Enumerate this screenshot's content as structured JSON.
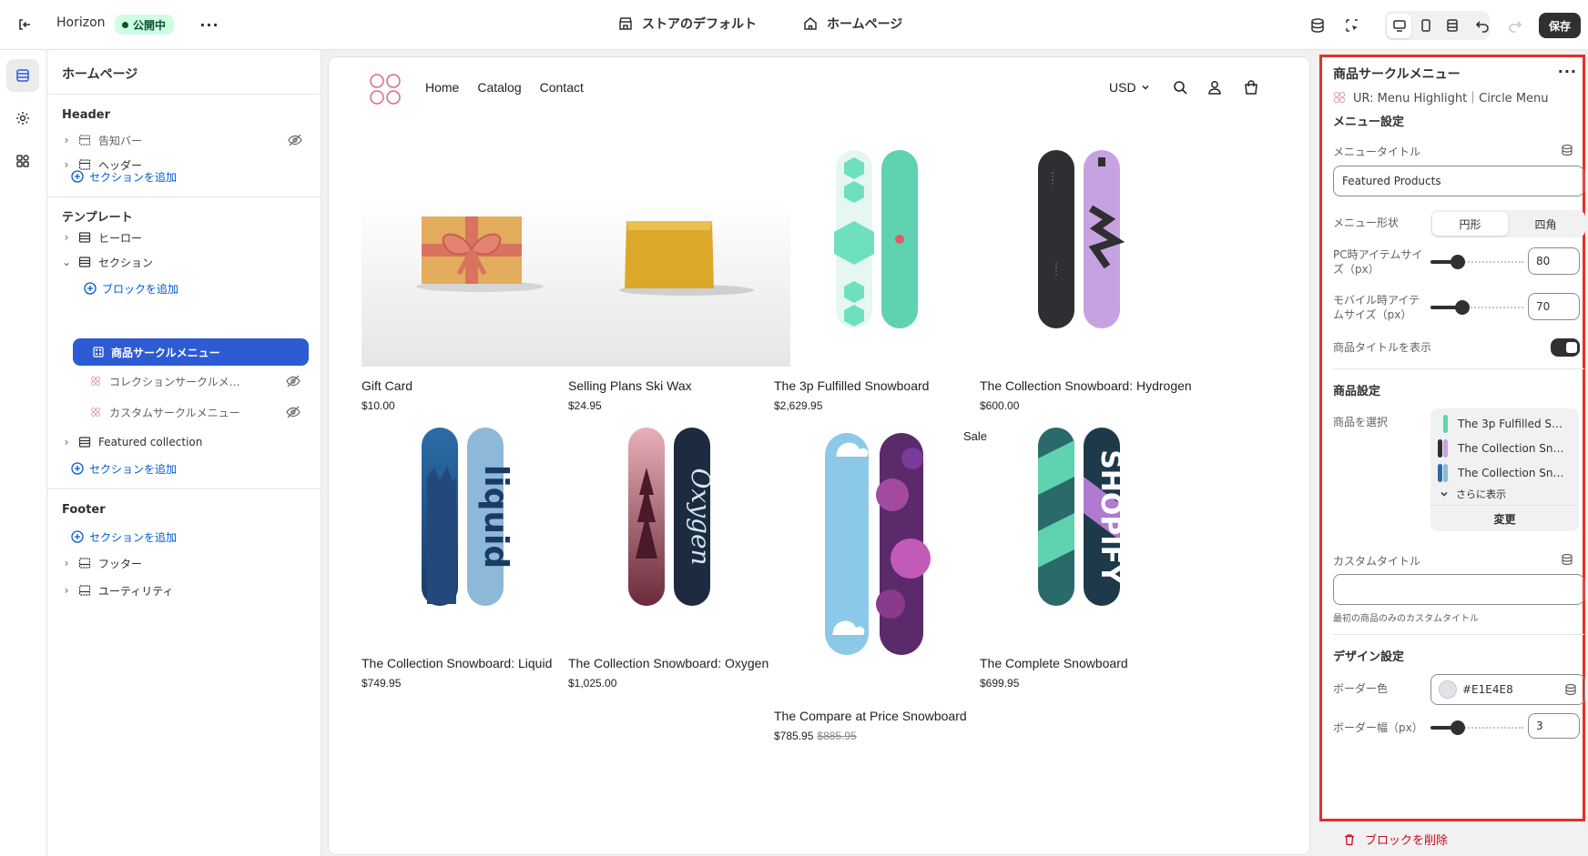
{
  "topbar": {
    "theme_name": "Horizon",
    "status": "公開中",
    "store_default": "ストアのデフォルト",
    "page": "ホームページ",
    "save": "保存"
  },
  "sidebar": {
    "title": "ホームページ",
    "header_group": "Header",
    "header_items": [
      "告知バー",
      "ヘッダー"
    ],
    "add_section": "セクションを追加",
    "template_group": "テンプレート",
    "hero": "ヒーロー",
    "section": "セクション",
    "add_block": "ブロックを追加",
    "selected_block": "商品サークルメニュー",
    "collection_block": "コレクションサークルメニ...",
    "custom_block": "カスタムサークルメニュー",
    "featured_collection": "Featured collection",
    "footer_group": "Footer",
    "footer": "フッター",
    "utility": "ユーティリティ"
  },
  "store": {
    "nav": [
      "Home",
      "Catalog",
      "Contact"
    ],
    "currency": "USD",
    "products": [
      {
        "name": "Gift Card",
        "price": "$10.00"
      },
      {
        "name": "Selling Plans Ski Wax",
        "price": "$24.95"
      },
      {
        "name": "The 3p Fulfilled Snowboard",
        "price": "$2,629.95"
      },
      {
        "name": "The Collection Snowboard: Hydrogen",
        "price": "$600.00"
      },
      {
        "name": "The Collection Snowboard: Liquid",
        "price": "$749.95"
      },
      {
        "name": "The Collection Snowboard: Oxygen",
        "price": "$1,025.00"
      },
      {
        "name": "The Compare at Price Snowboard",
        "price": "$785.95",
        "compare_price": "$885.95",
        "badge": "Sale"
      },
      {
        "name": "The Complete Snowboard",
        "price": "$699.95"
      }
    ]
  },
  "panel": {
    "title": "商品サークルメニュー",
    "subtitle": "UR: Menu Highlight｜Circle Menu",
    "menu_settings": "メニュー設定",
    "menu_title_label": "メニュータイトル",
    "menu_title_value": "Featured Products",
    "shape_label": "メニュー形状",
    "shape_options": [
      "円形",
      "四角"
    ],
    "shape_selected": "円形",
    "pc_size_label": "PC時アイテムサイズ（px）",
    "pc_size_value": "80",
    "mobile_size_label": "モバイル時アイテムサイズ（px）",
    "mobile_size_value": "70",
    "show_title_label": "商品タイトルを表示",
    "show_title_on": true,
    "product_settings": "商品設定",
    "select_products_label": "商品を選択",
    "selected_products": [
      "The 3p Fulfilled Sno...",
      "The Collection Snow...",
      "The Collection Snow..."
    ],
    "show_more": "さらに表示",
    "change": "変更",
    "custom_title_label": "カスタムタイトル",
    "custom_title_value": "",
    "custom_title_help": "最初の商品のみのカスタムタイトル",
    "design_settings": "デザイン設定",
    "border_color_label": "ボーダー色",
    "border_color_value": "#E1E4E8",
    "border_width_label": "ボーダー幅（px）",
    "border_width_value": "3",
    "delete_block": "ブロックを削除"
  },
  "colors": {
    "accent": "#2c5bd4",
    "highlight_border": "#e0312b",
    "status_bg": "#cdfee1"
  }
}
